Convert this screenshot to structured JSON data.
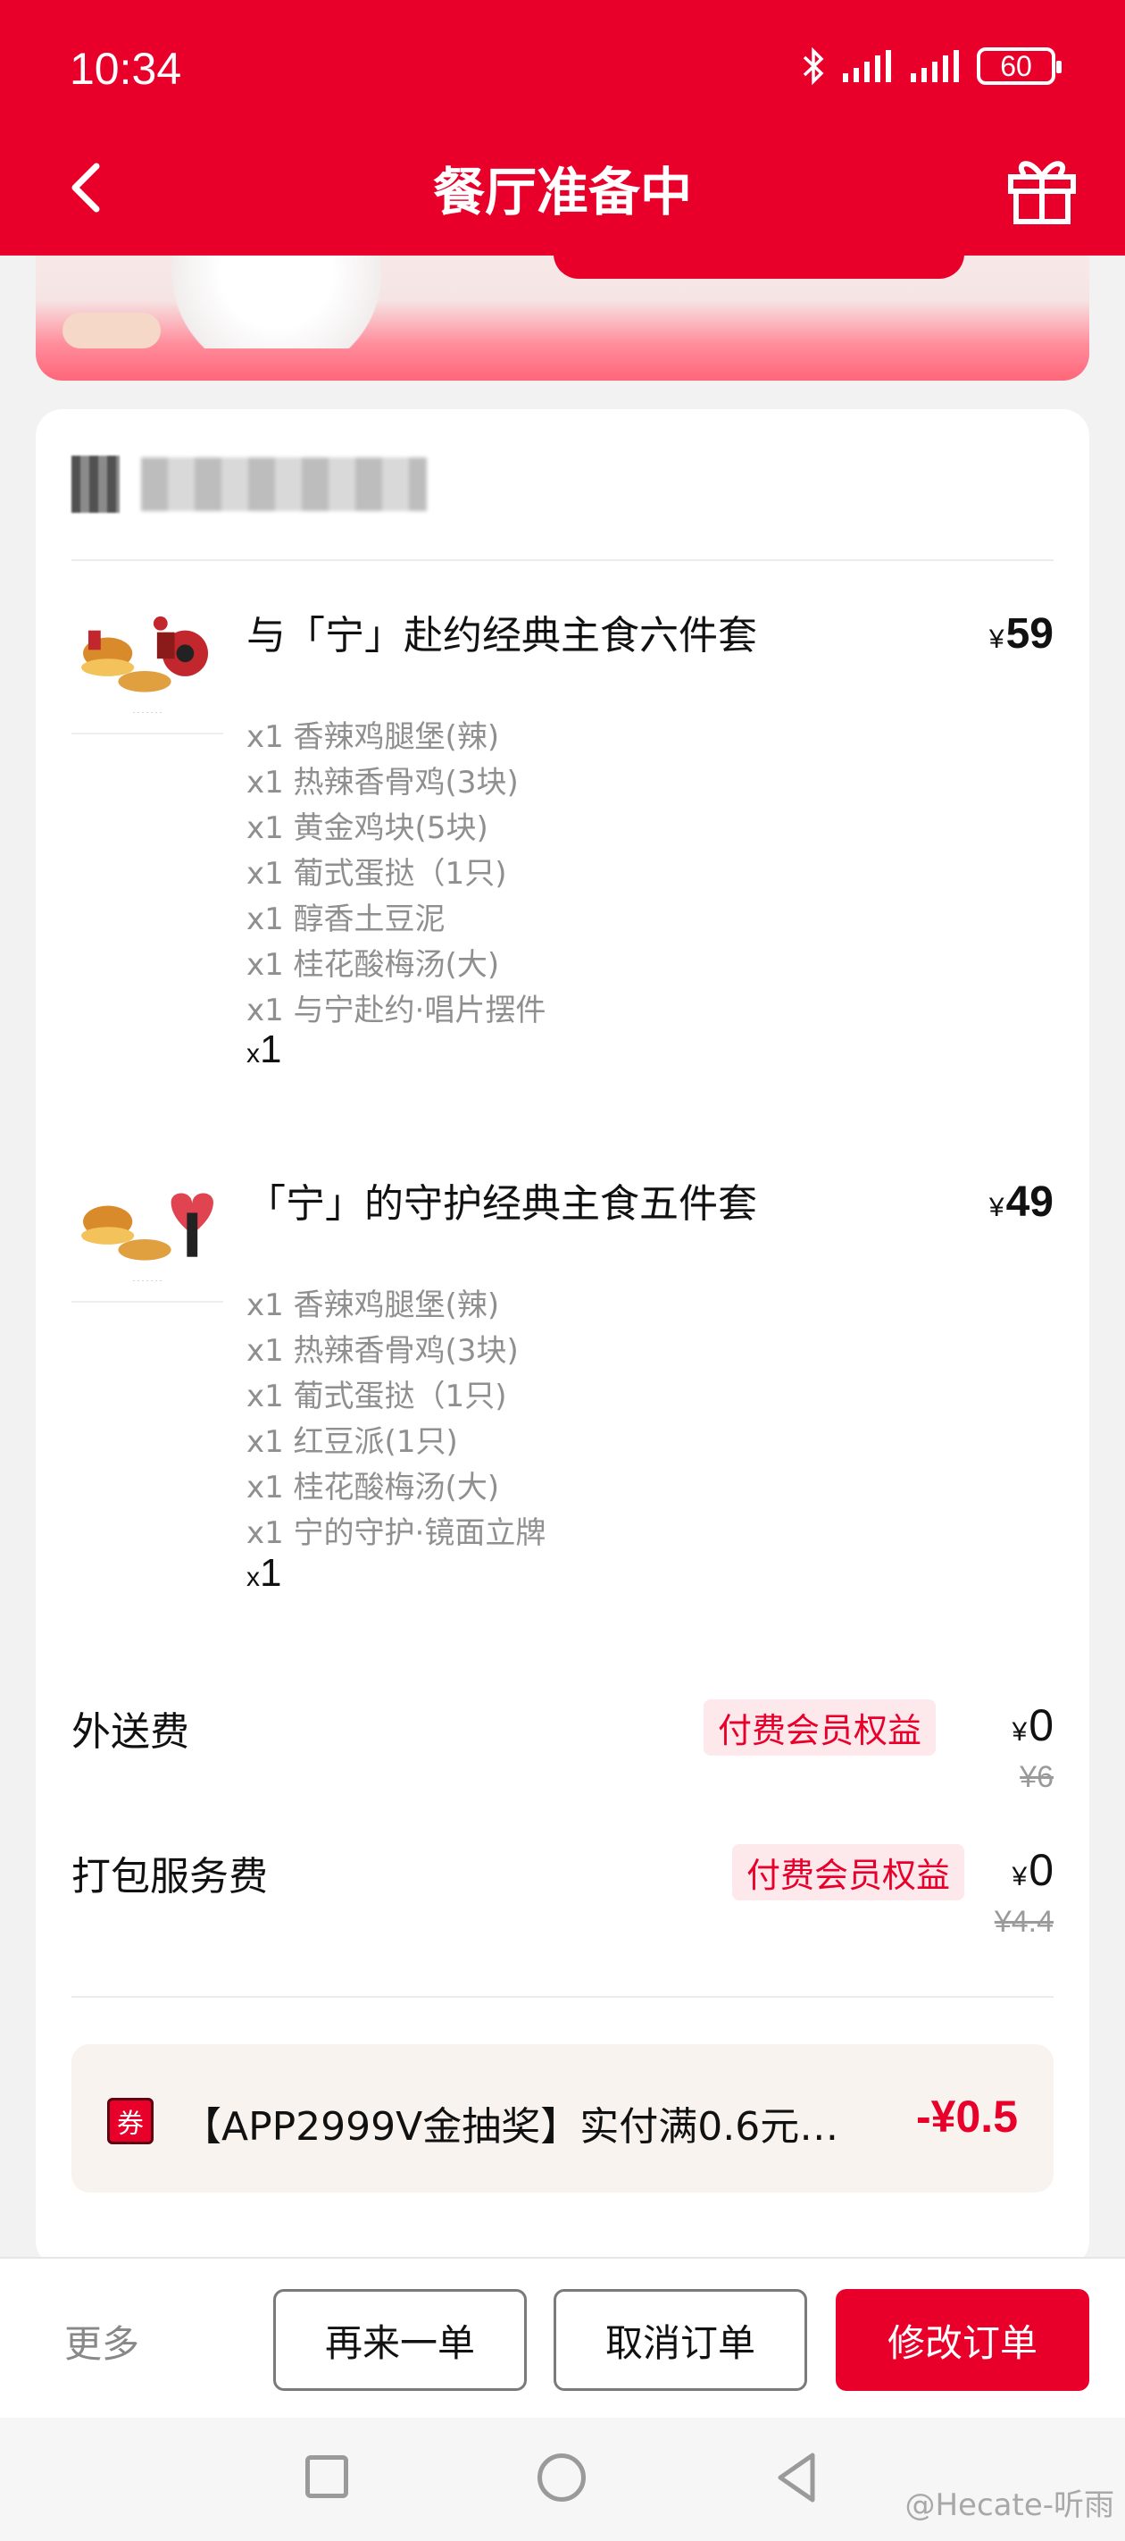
{
  "status_bar": {
    "time": "10:34",
    "battery": "60"
  },
  "header": {
    "title": "餐厅准备中"
  },
  "order": {
    "items": [
      {
        "title": "与「宁」赴约经典主食六件套",
        "price_symbol": "¥",
        "price": "59",
        "components": [
          "x1 香辣鸡腿堡(辣)",
          "x1 热辣香骨鸡(3块)",
          "x1 黄金鸡块(5块)",
          "x1 葡式蛋挞（1只)",
          "x1 醇香土豆泥",
          "x1 桂花酸梅汤(大)",
          "x1 与宁赴约·唱片摆件"
        ],
        "qty_prefix": "x",
        "qty": "1"
      },
      {
        "title": "「宁」的守护经典主食五件套",
        "price_symbol": "¥",
        "price": "49",
        "components": [
          "x1 香辣鸡腿堡(辣)",
          "x1 热辣香骨鸡(3块)",
          "x1 葡式蛋挞（1只)",
          "x1 红豆派(1只)",
          "x1 桂花酸梅汤(大)",
          "x1 宁的守护·镜面立牌"
        ],
        "qty_prefix": "x",
        "qty": "1"
      }
    ],
    "fees": [
      {
        "label": "外送费",
        "badge": "付费会员权益",
        "price_symbol": "¥",
        "price": "0",
        "original": "¥6"
      },
      {
        "label": "打包服务费",
        "badge": "付费会员权益",
        "price_symbol": "¥",
        "price": "0",
        "original": "¥4.4"
      }
    ],
    "coupon": {
      "tag": "券",
      "text": "【APP2999V金抽奖】实付满0.6元…",
      "amount": "-¥0.5"
    }
  },
  "actions": {
    "more": "更多",
    "reorder": "再来一单",
    "cancel": "取消订单",
    "modify": "修改订单"
  },
  "watermark": "@Hecate-听雨",
  "colors": {
    "brand": "#e8002b",
    "badge_bg": "#fde9ec",
    "coupon_bg": "#f8f3ee"
  }
}
